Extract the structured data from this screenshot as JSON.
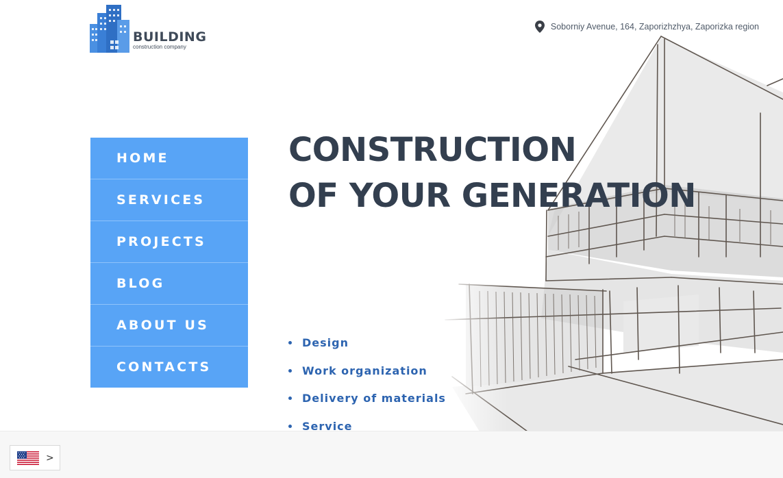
{
  "brand": {
    "name": "BUILDING",
    "tagline": "construction company",
    "logo_color": "#4a90e2"
  },
  "header": {
    "address": "Soborniy Avenue, 164, Zaporizhzhya, Zaporizka region",
    "address_icon": "map-pin-icon"
  },
  "nav": {
    "items": [
      {
        "label": "HOME"
      },
      {
        "label": "SERVICES"
      },
      {
        "label": "PROJECTS"
      },
      {
        "label": "BLOG"
      },
      {
        "label": "ABOUT US"
      },
      {
        "label": "CONTACTS"
      }
    ],
    "background": "#58a4f6"
  },
  "hero": {
    "title_line1": "CONSTRUCTION",
    "title_line2": "OF YOUR GENERATION",
    "services": [
      "Design",
      "Work organization",
      "Delivery of materials",
      "Service"
    ],
    "image": "building-sketch"
  },
  "footer": {
    "language_flag": "us-flag-icon",
    "language_chevron": ">"
  }
}
